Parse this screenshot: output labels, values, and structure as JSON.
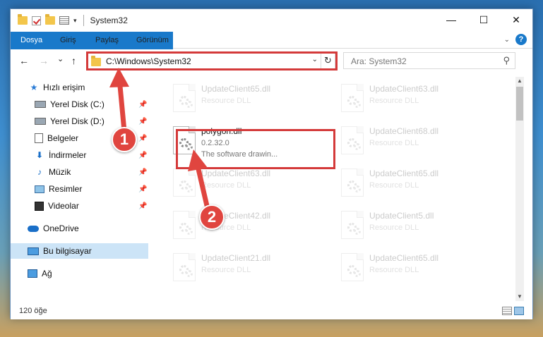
{
  "window": {
    "title": "System32"
  },
  "window_buttons": {
    "minimize": "—",
    "maximize": "☐",
    "close": "✕"
  },
  "ribbon": {
    "tabs": [
      "Dosya",
      "Giriş",
      "Paylaş",
      "Görünüm"
    ],
    "help": "?"
  },
  "nav": {
    "back": "←",
    "forward": "→",
    "recent": "⌄",
    "up": "↑"
  },
  "address": {
    "path": "C:\\Windows\\System32",
    "refresh": "↻"
  },
  "search": {
    "placeholder": "Ara: System32"
  },
  "sidebar": {
    "items": [
      {
        "label": "Hızlı erişim",
        "icon": "star-icon",
        "pinned": false
      },
      {
        "label": "Yerel Disk (C:)",
        "icon": "drive-icon",
        "pinned": true
      },
      {
        "label": "Yerel Disk (D:)",
        "icon": "drive-icon",
        "pinned": true
      },
      {
        "label": "Belgeler",
        "icon": "documents-icon",
        "pinned": true
      },
      {
        "label": "İndirmeler",
        "icon": "download-icon",
        "pinned": true
      },
      {
        "label": "Müzik",
        "icon": "music-icon",
        "pinned": true
      },
      {
        "label": "Resimler",
        "icon": "pictures-icon",
        "pinned": true
      },
      {
        "label": "Videolar",
        "icon": "videos-icon",
        "pinned": true
      },
      {
        "label": "OneDrive",
        "icon": "cloud-icon",
        "pinned": false
      },
      {
        "label": "Bu bilgisayar",
        "icon": "computer-icon",
        "pinned": false,
        "selected": true
      },
      {
        "label": "Ağ",
        "icon": "network-icon",
        "pinned": false
      }
    ]
  },
  "files": [
    {
      "name": "UpdateClient65.dll",
      "type": "Resource DLL"
    },
    {
      "name": "UpdateClient63.dll",
      "type": "Resource DLL"
    },
    {
      "name": "polygon.dll",
      "version": "0.2.32.0",
      "description": "The software drawin...",
      "highlighted": true
    },
    {
      "name": "UpdateClient68.dll",
      "type": "Resource DLL"
    },
    {
      "name": "UpdateClient63.dll",
      "type": "Resource DLL"
    },
    {
      "name": "UpdateClient65.dll",
      "type": "Resource DLL"
    },
    {
      "name": "UpdateClient42.dll",
      "type": "Resource DLL"
    },
    {
      "name": "UpdateClient5.dll",
      "type": "Resource DLL"
    },
    {
      "name": "UpdateClient21.dll",
      "type": "Resource DLL"
    },
    {
      "name": "UpdateClient65.dll",
      "type": "Resource DLL"
    }
  ],
  "status": {
    "count": "120 öğe"
  },
  "annotations": {
    "step1": "1",
    "step2": "2",
    "color": "#e0453f"
  }
}
